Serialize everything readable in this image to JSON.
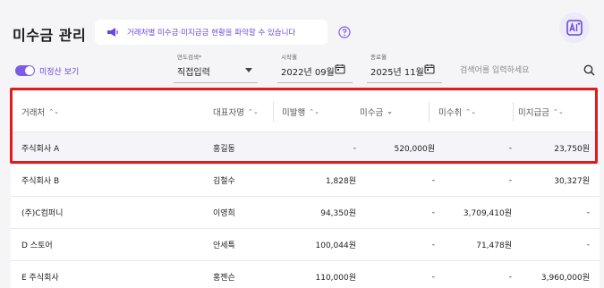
{
  "page": {
    "title": "미수금 관리"
  },
  "banner": {
    "text": "거래처별 미수금·미지급금 현황을 파악할 수 있습니다"
  },
  "toggle": {
    "label": "미정산 보기",
    "on": true
  },
  "filters": {
    "year_type": {
      "label": "연도검색*",
      "value": "직접입력"
    },
    "start": {
      "label": "시작월",
      "value": "2022년 09월"
    },
    "end": {
      "label": "종료월",
      "value": "2025년 11월"
    }
  },
  "search": {
    "placeholder": "검색어를 입력하세요",
    "value": ""
  },
  "table": {
    "columns": [
      {
        "label": "거래처",
        "sort": "⌃⌄"
      },
      {
        "label": "대표자명",
        "sort": "⌃⌄"
      },
      {
        "label": "미발행",
        "sort": "⌃⌄"
      },
      {
        "label": "미수금",
        "sort": "⌄"
      },
      {
        "label": "미수취",
        "sort": "⌃⌄"
      },
      {
        "label": "미지급금",
        "sort": "⌃⌄"
      }
    ],
    "rows": [
      {
        "name": "주식회사 A",
        "rep": "홍길동",
        "unissued": "-",
        "receivable": "520,000원",
        "unreceived": "-",
        "payable": "23,750원"
      },
      {
        "name": "주식회사 B",
        "rep": "김철수",
        "unissued": "1,828원",
        "receivable": "-",
        "unreceived": "-",
        "payable": "30,327원"
      },
      {
        "name": "(주)C컴퍼니",
        "rep": "이영희",
        "unissued": "94,350원",
        "receivable": "-",
        "unreceived": "3,709,410원",
        "payable": "-"
      },
      {
        "name": "D 스토어",
        "rep": "안세특",
        "unissued": "100,044원",
        "receivable": "-",
        "unreceived": "71,478원",
        "payable": "-"
      },
      {
        "name": "E 주식회사",
        "rep": "홍젠슨",
        "unissued": "110,000원",
        "receivable": "-",
        "unreceived": "-",
        "payable": "3,960,000원"
      }
    ]
  },
  "colors": {
    "accent": "#7b5ce6",
    "highlight": "#e01b1b"
  },
  "icons": [
    "megaphone-icon",
    "help-icon",
    "ai-icon",
    "calendar-icon",
    "search-icon",
    "chevron-down-icon",
    "sort-icon"
  ]
}
